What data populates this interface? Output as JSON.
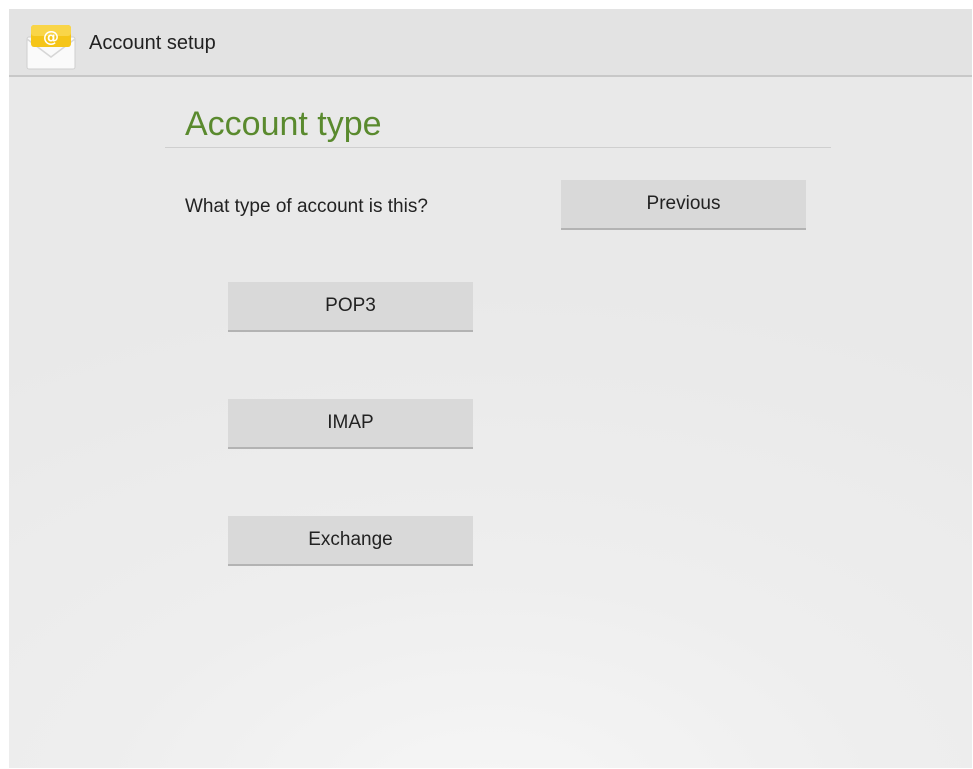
{
  "action_bar": {
    "app_icon": "email-envelope-icon",
    "title": "Account setup"
  },
  "page": {
    "heading": "Account type",
    "question": "What type of account is this?"
  },
  "buttons": {
    "previous": "Previous",
    "pop3": "POP3",
    "imap": "IMAP",
    "exchange": "Exchange"
  },
  "colors": {
    "heading": "#5a8a2e",
    "button_bg": "#d9d9d9",
    "action_bar_bg": "#e3e3e3",
    "icon_yellow": "#f5c518"
  }
}
